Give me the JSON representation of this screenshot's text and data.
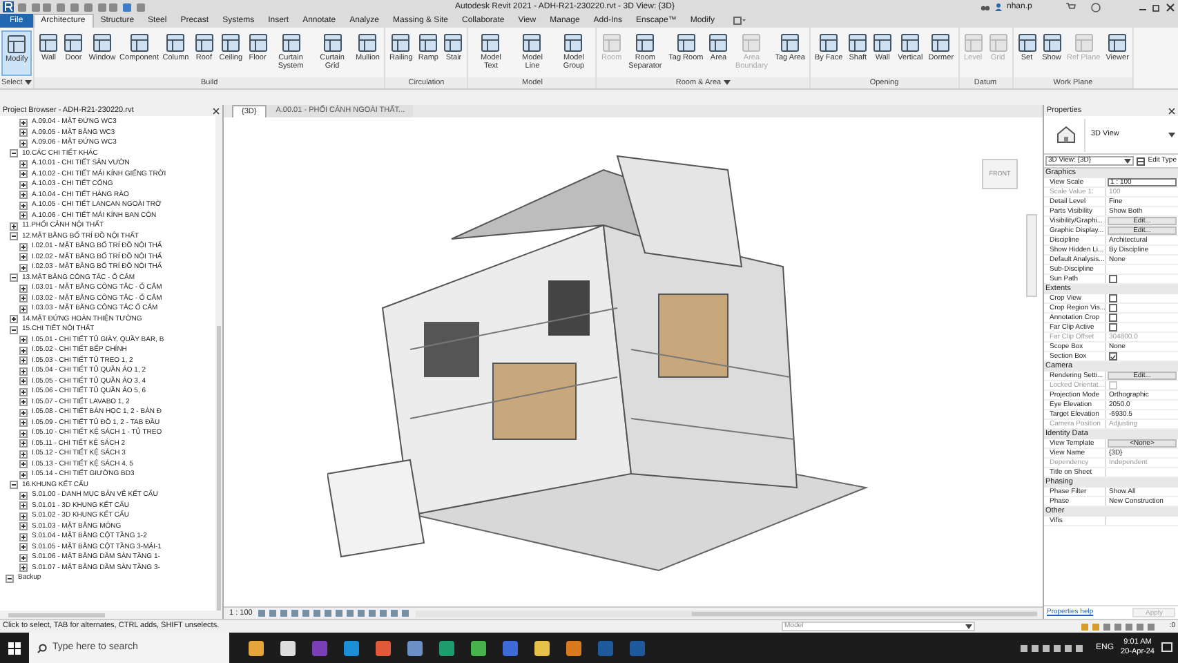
{
  "title_bar": {
    "title": "Autodesk Revit 2021 - ADH-R21-230220.rvt - 3D View: {3D}",
    "user": "nhan.p"
  },
  "ribbon_tabs": [
    {
      "label": "File",
      "kind": "application",
      "selected": false
    },
    {
      "label": "Architecture",
      "kind": "tab",
      "selected": true
    },
    {
      "label": "Structure",
      "kind": "tab",
      "selected": false
    },
    {
      "label": "Steel",
      "kind": "tab",
      "selected": false
    },
    {
      "label": "Precast",
      "kind": "tab",
      "selected": false
    },
    {
      "label": "Systems",
      "kind": "tab",
      "selected": false
    },
    {
      "label": "Insert",
      "kind": "tab",
      "selected": false
    },
    {
      "label": "Annotate",
      "kind": "tab",
      "selected": false
    },
    {
      "label": "Analyze",
      "kind": "tab",
      "selected": false
    },
    {
      "label": "Massing & Site",
      "kind": "tab",
      "selected": false
    },
    {
      "label": "Collaborate",
      "kind": "tab",
      "selected": false
    },
    {
      "label": "View",
      "kind": "tab",
      "selected": false
    },
    {
      "label": "Manage",
      "kind": "tab",
      "selected": false
    },
    {
      "label": "Add-Ins",
      "kind": "tab",
      "selected": false
    },
    {
      "label": "Enscape™",
      "kind": "tab",
      "selected": false
    },
    {
      "label": "Modify",
      "kind": "tab",
      "selected": false
    }
  ],
  "ribbon_panels": [
    {
      "label": "Select",
      "dropdown": true,
      "tools": [
        {
          "label": "Modify",
          "disabled": false,
          "selected": true
        }
      ]
    },
    {
      "label": "Build",
      "dropdown": false,
      "tools": [
        {
          "label": "Wall",
          "disabled": false,
          "selected": false
        },
        {
          "label": "Door",
          "disabled": false,
          "selected": false
        },
        {
          "label": "Window",
          "disabled": false,
          "selected": false
        },
        {
          "label": "Component",
          "disabled": false,
          "selected": false
        },
        {
          "label": "Column",
          "disabled": false,
          "selected": false
        },
        {
          "label": "Roof",
          "disabled": false,
          "selected": false
        },
        {
          "label": "Ceiling",
          "disabled": false,
          "selected": false
        },
        {
          "label": "Floor",
          "disabled": false,
          "selected": false
        },
        {
          "label": "Curtain System",
          "disabled": false,
          "selected": false
        },
        {
          "label": "Curtain Grid",
          "disabled": false,
          "selected": false
        },
        {
          "label": "Mullion",
          "disabled": false,
          "selected": false
        }
      ]
    },
    {
      "label": "Circulation",
      "dropdown": false,
      "tools": [
        {
          "label": "Railing",
          "disabled": false,
          "selected": false
        },
        {
          "label": "Ramp",
          "disabled": false,
          "selected": false
        },
        {
          "label": "Stair",
          "disabled": false,
          "selected": false
        }
      ]
    },
    {
      "label": "Model",
      "dropdown": false,
      "tools": [
        {
          "label": "Model Text",
          "disabled": false,
          "selected": false
        },
        {
          "label": "Model Line",
          "disabled": false,
          "selected": false
        },
        {
          "label": "Model Group",
          "disabled": false,
          "selected": false
        }
      ]
    },
    {
      "label": "Room & Area",
      "dropdown": true,
      "tools": [
        {
          "label": "Room",
          "disabled": true,
          "selected": false
        },
        {
          "label": "Room Separator",
          "disabled": false,
          "selected": false
        },
        {
          "label": "Tag Room",
          "disabled": false,
          "selected": false
        },
        {
          "label": "Area",
          "disabled": false,
          "selected": false
        },
        {
          "label": "Area Boundary",
          "disabled": true,
          "selected": false
        },
        {
          "label": "Tag Area",
          "disabled": false,
          "selected": false
        }
      ]
    },
    {
      "label": "Opening",
      "dropdown": false,
      "tools": [
        {
          "label": "By Face",
          "disabled": false,
          "selected": false
        },
        {
          "label": "Shaft",
          "disabled": false,
          "selected": false
        },
        {
          "label": "Wall",
          "disabled": false,
          "selected": false
        },
        {
          "label": "Vertical",
          "disabled": false,
          "selected": false
        },
        {
          "label": "Dormer",
          "disabled": false,
          "selected": false
        }
      ]
    },
    {
      "label": "Datum",
      "dropdown": false,
      "tools": [
        {
          "label": "Level",
          "disabled": true,
          "selected": false
        },
        {
          "label": "Grid",
          "disabled": true,
          "selected": false
        }
      ]
    },
    {
      "label": "Work Plane",
      "dropdown": false,
      "tools": [
        {
          "label": "Set",
          "disabled": false,
          "selected": false
        },
        {
          "label": "Show",
          "disabled": false,
          "selected": false
        },
        {
          "label": "Ref Plane",
          "disabled": true,
          "selected": false
        },
        {
          "label": "Viewer",
          "disabled": false,
          "selected": false
        }
      ]
    }
  ],
  "project_browser": {
    "title": "Project Browser - ADH-R21-230220.rvt",
    "tree": [
      {
        "label": "A.09.04 - MẶT ĐỨNG WC3",
        "kind": "view",
        "expanded": false
      },
      {
        "label": "A.09.05 - MẶT BẰNG WC3",
        "kind": "view",
        "expanded": false
      },
      {
        "label": "A.09.06 - MẶT ĐỨNG WC3",
        "kind": "view",
        "expanded": false
      },
      {
        "label": "10.CÁC CHI TIẾT KHÁC",
        "kind": "group",
        "expanded": true,
        "children": [
          {
            "label": "A.10.01 - CHI TIẾT SÂN VƯỜN",
            "kind": "view",
            "expanded": false
          },
          {
            "label": "A.10.02 - CHI TIẾT MÁI KÍNH GIẾNG TRỜI",
            "kind": "view",
            "expanded": false
          },
          {
            "label": "A.10.03 - CHI TIẾT CỔNG",
            "kind": "view",
            "expanded": false
          },
          {
            "label": "A.10.04 - CHI TIẾT HÀNG RÀO",
            "kind": "view",
            "expanded": false
          },
          {
            "label": "A.10.05 - CHI TIẾT LANCAN NGOÀI TRỜ",
            "kind": "view",
            "expanded": false
          },
          {
            "label": "A.10.06 - CHI TIẾT MÁI KÍNH BAN CÔN",
            "kind": "view",
            "expanded": false
          }
        ]
      },
      {
        "label": "11.PHỐI CẢNH NỘI THẤT",
        "kind": "group",
        "expanded": false
      },
      {
        "label": "12.MẶT BẰNG BỐ TRÍ ĐỒ NỘI THẤT",
        "kind": "group",
        "expanded": true,
        "children": [
          {
            "label": "I.02.01 - MẶT BẰNG BỐ TRÍ ĐỒ NỘI THẤ",
            "kind": "view",
            "expanded": false
          },
          {
            "label": "I.02.02 - MẶT BẰNG BỐ TRÍ ĐỒ NỘI THẤ",
            "kind": "view",
            "expanded": false
          },
          {
            "label": "I.02.03 - MẶT BẰNG BỐ TRÍ ĐỒ NỘI THẤ",
            "kind": "view",
            "expanded": false
          }
        ]
      },
      {
        "label": "13.MẶT BẰNG CÔNG TẮC - Ổ CẮM",
        "kind": "group",
        "expanded": true,
        "children": [
          {
            "label": "I.03.01 - MẶT BẰNG CÔNG TẮC - Ổ CẮM",
            "kind": "view",
            "expanded": false
          },
          {
            "label": "I.03.02 - MẶT BẰNG CÔNG TẮC - Ổ CẮM",
            "kind": "view",
            "expanded": false
          },
          {
            "label": "I.03.03 - MẶT BẰNG CÔNG TẮC Ổ CẮM",
            "kind": "view",
            "expanded": false
          }
        ]
      },
      {
        "label": "14.MẶT ĐỨNG HOÀN THIỆN TƯỜNG",
        "kind": "group",
        "expanded": false
      },
      {
        "label": "15.CHI TIẾT NỘI THẤT",
        "kind": "group",
        "expanded": true,
        "children": [
          {
            "label": "I.05.01 - CHI TIẾT TỦ GIÀY, QUẦY BAR, B",
            "kind": "view",
            "expanded": false
          },
          {
            "label": "I.05.02 - CHI TIẾT BẾP CHÍNH",
            "kind": "view",
            "expanded": false
          },
          {
            "label": "I.05.03 - CHI TIẾT TỦ TREO 1, 2",
            "kind": "view",
            "expanded": false
          },
          {
            "label": "I.05.04 - CHI TIẾT TỦ QUẦN ÁO 1, 2",
            "kind": "view",
            "expanded": false
          },
          {
            "label": "I.05.05 - CHI TIẾT TỦ QUẦN ÁO 3, 4",
            "kind": "view",
            "expanded": false
          },
          {
            "label": "I.05.06 - CHI TIẾT TỦ QUẦN ÁO 5, 6",
            "kind": "view",
            "expanded": false
          },
          {
            "label": "I.05.07 - CHI TIẾT LAVABO 1, 2",
            "kind": "view",
            "expanded": false
          },
          {
            "label": "I.05.08 - CHI TIẾT BÀN HỌC 1, 2 - BÀN Đ",
            "kind": "view",
            "expanded": false
          },
          {
            "label": "I.05.09 - CHI TIẾT TỦ ĐỒ 1, 2 - TAB ĐẦU",
            "kind": "view",
            "expanded": false
          },
          {
            "label": "I.05.10 - CHI TIẾT KỆ SÁCH 1 - TỦ TREO",
            "kind": "view",
            "expanded": false
          },
          {
            "label": "I.05.11 - CHI TIẾT KỆ SÁCH 2",
            "kind": "view",
            "expanded": false
          },
          {
            "label": "I.05.12 - CHI TIẾT KỆ SÁCH 3",
            "kind": "view",
            "expanded": false
          },
          {
            "label": "I.05.13 - CHI TIẾT KỆ SÁCH 4, 5",
            "kind": "view",
            "expanded": false
          },
          {
            "label": "I.05.14 - CHI TIẾT GIƯỜNG BD3",
            "kind": "view",
            "expanded": false
          }
        ]
      },
      {
        "label": "16.KHUNG KẾT CẤU",
        "kind": "group",
        "expanded": true,
        "children": [
          {
            "label": "S.01.00 - DANH MỤC BẢN VẼ KẾT CẤU",
            "kind": "view",
            "expanded": false
          },
          {
            "label": "S.01.01 - 3D KHUNG KẾT CẤU",
            "kind": "view",
            "expanded": false
          },
          {
            "label": "S.01.02 - 3D KHUNG KẾT CẤU",
            "kind": "view",
            "expanded": false
          },
          {
            "label": "S.01.03 - MẶT BẰNG MÓNG",
            "kind": "view",
            "expanded": false
          },
          {
            "label": "S.01.04 - MẶT BẰNG CỘT TẦNG 1-2",
            "kind": "view",
            "expanded": false
          },
          {
            "label": "S.01.05 - MẶT BẰNG CỘT TẦNG 3-MÁI-1",
            "kind": "view",
            "expanded": false
          },
          {
            "label": "S.01.06 - MẶT BẰNG DẦM SÀN TẦNG 1-",
            "kind": "view",
            "expanded": false
          },
          {
            "label": "S.01.07 - MẶT BẰNG DẦM SÀN TẦNG 3-",
            "kind": "view",
            "expanded": false
          }
        ]
      },
      {
        "label": "Backup",
        "kind": "root",
        "expanded": true
      }
    ]
  },
  "view_tabs": [
    {
      "label": "{3D}",
      "selected": true
    },
    {
      "label": "A.00.01 - PHỐI CẢNH NGOÀI THẤT...",
      "selected": false
    }
  ],
  "view_cube": {
    "face": "FRONT"
  },
  "view_control_bar": {
    "scale": "1 : 100"
  },
  "properties": {
    "title": "Properties",
    "type_name": "3D View",
    "instance": "3D View: {3D}",
    "edit_type": "Edit Type",
    "groups": [
      {
        "name": "Graphics",
        "rows": [
          {
            "name": "View Scale",
            "value": "1 : 100",
            "kind": "field",
            "disabled": false
          },
          {
            "name": "Scale Value    1:",
            "value": "100",
            "kind": "text",
            "disabled": true
          },
          {
            "name": "Detail Level",
            "value": "Fine",
            "kind": "text",
            "disabled": false
          },
          {
            "name": "Parts Visibility",
            "value": "Show Both",
            "kind": "text",
            "disabled": false
          },
          {
            "name": "Visibility/Graphi...",
            "value": "Edit...",
            "kind": "button",
            "disabled": false
          },
          {
            "name": "Graphic Display...",
            "value": "Edit...",
            "kind": "button",
            "disabled": false
          },
          {
            "name": "Discipline",
            "value": "Architectural",
            "kind": "text",
            "disabled": false
          },
          {
            "name": "Show Hidden Li...",
            "value": "By Discipline",
            "kind": "text",
            "disabled": false
          },
          {
            "name": "Default Analysis...",
            "value": "None",
            "kind": "text",
            "disabled": false
          },
          {
            "name": "Sub-Discipline",
            "kind": "text",
            "disabled": false
          },
          {
            "name": "Sun Path",
            "kind": "checkbox",
            "checked": false,
            "disabled": false
          }
        ]
      },
      {
        "name": "Extents",
        "rows": [
          {
            "name": "Crop View",
            "kind": "checkbox",
            "checked": false,
            "disabled": false
          },
          {
            "name": "Crop Region Vis...",
            "kind": "checkbox",
            "checked": false,
            "disabled": false
          },
          {
            "name": "Annotation Crop",
            "kind": "checkbox",
            "checked": false,
            "disabled": false
          },
          {
            "name": "Far Clip Active",
            "kind": "checkbox",
            "checked": false,
            "disabled": false
          },
          {
            "name": "Far Clip Offset",
            "value": "304800.0",
            "kind": "text",
            "disabled": true
          },
          {
            "name": "Scope Box",
            "value": "None",
            "kind": "text",
            "disabled": false
          },
          {
            "name": "Section Box",
            "kind": "checkbox",
            "checked": true,
            "disabled": false
          }
        ]
      },
      {
        "name": "Camera",
        "rows": [
          {
            "name": "Rendering Setti...",
            "value": "Edit...",
            "kind": "button",
            "disabled": false
          },
          {
            "name": "Locked Orientat...",
            "kind": "checkbox",
            "checked": false,
            "disabled": true
          },
          {
            "name": "Projection Mode",
            "value": "Orthographic",
            "kind": "text",
            "disabled": false
          },
          {
            "name": "Eye Elevation",
            "value": "2050.0",
            "kind": "text",
            "disabled": false
          },
          {
            "name": "Target Elevation",
            "value": "-6930.5",
            "kind": "text",
            "disabled": false
          },
          {
            "name": "Camera Position",
            "value": "Adjusting",
            "kind": "text",
            "disabled": true
          }
        ]
      },
      {
        "name": "Identity Data",
        "rows": [
          {
            "name": "View Template",
            "value": "<None>",
            "kind": "button",
            "disabled": false
          },
          {
            "name": "View Name",
            "value": "{3D}",
            "kind": "text",
            "disabled": false
          },
          {
            "name": "Dependency",
            "value": "Independent",
            "kind": "text",
            "disabled": true
          },
          {
            "name": "Title on Sheet",
            "kind": "text",
            "disabled": false
          }
        ]
      },
      {
        "name": "Phasing",
        "rows": [
          {
            "name": "Phase Filter",
            "value": "Show All",
            "kind": "text",
            "disabled": false
          },
          {
            "name": "Phase",
            "value": "New Construction",
            "kind": "text",
            "disabled": false
          }
        ]
      },
      {
        "name": "Other",
        "rows": [
          {
            "name": "Vifis",
            "kind": "text",
            "disabled": false
          }
        ]
      }
    ],
    "help_link": "Properties help",
    "apply": {
      "label": "Apply",
      "disabled": true
    }
  },
  "status_bar": {
    "message": "Click to select, TAB for alternates, CTRL adds, SHIFT unselects.",
    "workset": "Model",
    "filter_count": ":0"
  },
  "taskbar": {
    "search_placeholder": "Type here to search",
    "language": "ENG",
    "time": "9:01 AM",
    "date": "20-Apr-24"
  }
}
